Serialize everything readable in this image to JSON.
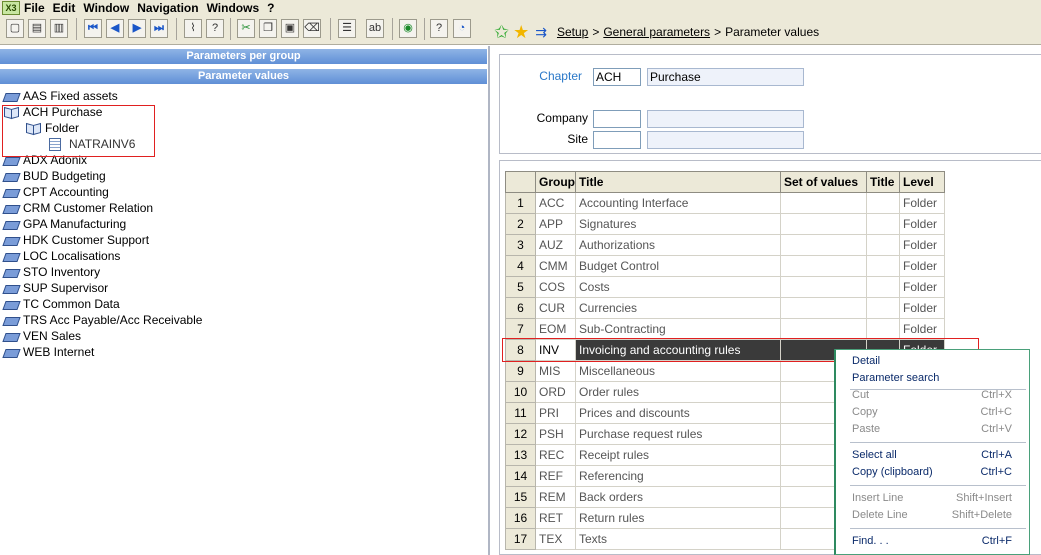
{
  "menu": {
    "logo": "X3",
    "items": [
      "File",
      "Edit",
      "Window",
      "Navigation",
      "Windows",
      "?"
    ]
  },
  "breadcrumb": {
    "setup": "Setup",
    "sep1": ">",
    "general": "General parameters",
    "sep2": ">",
    "current": "Parameter values"
  },
  "left": {
    "section1": "Parameters per group",
    "section2": "Parameter values",
    "tree": [
      {
        "label": "AAS Fixed assets"
      },
      {
        "label": "ACH Purchase"
      },
      {
        "label": "Folder"
      },
      {
        "label": "NATRAINV6"
      },
      {
        "label": "ADX Adonix"
      },
      {
        "label": "BUD Budgeting"
      },
      {
        "label": "CPT Accounting"
      },
      {
        "label": "CRM Customer Relation"
      },
      {
        "label": "GPA Manufacturing"
      },
      {
        "label": "HDK Customer Support"
      },
      {
        "label": "LOC Localisations"
      },
      {
        "label": "STO Inventory"
      },
      {
        "label": "SUP Supervisor"
      },
      {
        "label": "TC Common Data"
      },
      {
        "label": "TRS Acc Payable/Acc Receivable"
      },
      {
        "label": "VEN Sales"
      },
      {
        "label": "WEB Internet"
      }
    ]
  },
  "form": {
    "chapter_label": "Chapter",
    "chapter_code": "ACH",
    "chapter_name": "Purchase",
    "company_label": "Company",
    "company_code": "",
    "company_name": "",
    "site_label": "Site",
    "site_code": "",
    "site_name": ""
  },
  "grid": {
    "headers": [
      "",
      "Group",
      "Title",
      "Set of values",
      "Title",
      "Level"
    ],
    "rows": [
      {
        "n": "1",
        "group": "ACC",
        "title": "Accounting Interface",
        "level": "Folder"
      },
      {
        "n": "2",
        "group": "APP",
        "title": "Signatures",
        "level": "Folder"
      },
      {
        "n": "3",
        "group": "AUZ",
        "title": "Authorizations",
        "level": "Folder"
      },
      {
        "n": "4",
        "group": "CMM",
        "title": "Budget Control",
        "level": "Folder"
      },
      {
        "n": "5",
        "group": "COS",
        "title": "Costs",
        "level": "Folder"
      },
      {
        "n": "6",
        "group": "CUR",
        "title": "Currencies",
        "level": "Folder"
      },
      {
        "n": "7",
        "group": "EOM",
        "title": "Sub-Contracting",
        "level": "Folder"
      },
      {
        "n": "8",
        "group": "INV",
        "title": "Invoicing and accounting rules",
        "level": "Folder"
      },
      {
        "n": "9",
        "group": "MIS",
        "title": "Miscellaneous",
        "level": ""
      },
      {
        "n": "10",
        "group": "ORD",
        "title": "Order rules",
        "level": ""
      },
      {
        "n": "11",
        "group": "PRI",
        "title": "Prices and discounts",
        "level": ""
      },
      {
        "n": "12",
        "group": "PSH",
        "title": "Purchase request rules",
        "level": ""
      },
      {
        "n": "13",
        "group": "REC",
        "title": "Receipt rules",
        "level": ""
      },
      {
        "n": "14",
        "group": "REF",
        "title": "Referencing",
        "level": ""
      },
      {
        "n": "15",
        "group": "REM",
        "title": "Back orders",
        "level": ""
      },
      {
        "n": "16",
        "group": "RET",
        "title": "Return rules",
        "level": ""
      },
      {
        "n": "17",
        "group": "TEX",
        "title": "Texts",
        "level": ""
      }
    ]
  },
  "context_menu": {
    "detail": "Detail",
    "param_search": "Parameter search",
    "cut": "Cut",
    "cut_sc": "Ctrl+X",
    "copy": "Copy",
    "copy_sc": "Ctrl+C",
    "paste": "Paste",
    "paste_sc": "Ctrl+V",
    "select_all": "Select all",
    "select_all_sc": "Ctrl+A",
    "copy_clip": "Copy (clipboard)",
    "copy_clip_sc": "Ctrl+C",
    "insert_line": "Insert Line",
    "insert_line_sc": "Shift+Insert",
    "delete_line": "Delete Line",
    "delete_line_sc": "Shift+Delete",
    "find": "Find. . .",
    "find_sc": "Ctrl+F"
  }
}
